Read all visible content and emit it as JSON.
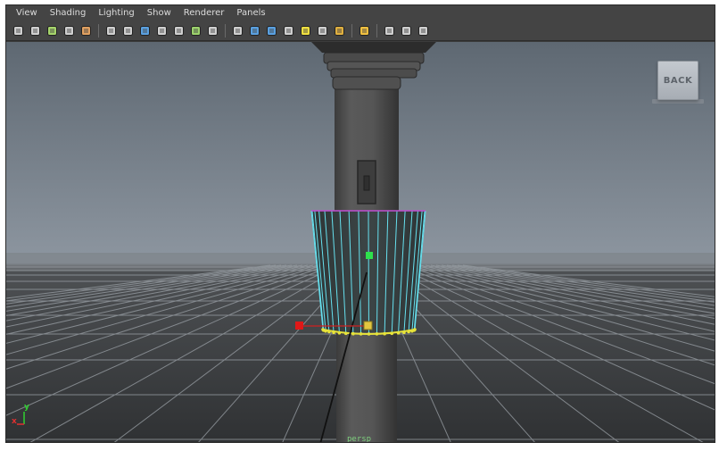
{
  "menu": [
    "View",
    "Shading",
    "Lighting",
    "Show",
    "Renderer",
    "Panels"
  ],
  "toolbar_icons": [
    {
      "name": "select-camera-icon",
      "color": "#cfcfcf"
    },
    {
      "name": "camera-attributes-icon",
      "color": "#cfcfcf"
    },
    {
      "name": "bookmarks-icon",
      "color": "#a6d46b"
    },
    {
      "name": "image-plane-icon",
      "color": "#cfcfcf"
    },
    {
      "name": "2d-pan-zoom-icon",
      "color": "#e0a060"
    },
    {
      "sep": true
    },
    {
      "name": "grid-icon",
      "color": "#cfcfcf"
    },
    {
      "name": "film-gate-icon",
      "color": "#cfcfcf"
    },
    {
      "name": "resolution-gate-icon",
      "color": "#5aa0e0"
    },
    {
      "name": "gate-mask-icon",
      "color": "#cfcfcf"
    },
    {
      "name": "field-chart-icon",
      "color": "#cfcfcf"
    },
    {
      "name": "safe-action-icon",
      "color": "#9cd26c"
    },
    {
      "name": "safe-title-icon",
      "color": "#cfcfcf"
    },
    {
      "sep": true
    },
    {
      "name": "wireframe-icon",
      "color": "#cfcfcf"
    },
    {
      "name": "smooth-shade-icon",
      "color": "#5aa0e0"
    },
    {
      "name": "wireframe-on-shaded-icon",
      "color": "#5aa0e0"
    },
    {
      "name": "textured-icon",
      "color": "#cfcfcf"
    },
    {
      "name": "use-all-lights-icon",
      "color": "#f0e040"
    },
    {
      "name": "shadows-icon",
      "color": "#cfcfcf"
    },
    {
      "name": "high-quality-icon",
      "color": "#e0b040"
    },
    {
      "sep": true
    },
    {
      "name": "isolate-select-icon",
      "color": "#f0c040"
    },
    {
      "sep": true
    },
    {
      "name": "xray-icon",
      "color": "#cfcfcf"
    },
    {
      "name": "xray-joints-icon",
      "color": "#cfcfcf"
    },
    {
      "name": "xray-components-icon",
      "color": "#cfcfcf"
    }
  ],
  "back_button": "BACK",
  "camera_label": "persp",
  "axis": {
    "x": "x",
    "y": "y",
    "x_color": "#e03030",
    "y_color": "#30d030"
  },
  "colors": {
    "bg_top": "#6a7480",
    "bg_bottom": "#3d3f42",
    "wire": "#66e0ee",
    "vertex": "#e7e33a",
    "edge_highlight": "#c04fd0"
  }
}
